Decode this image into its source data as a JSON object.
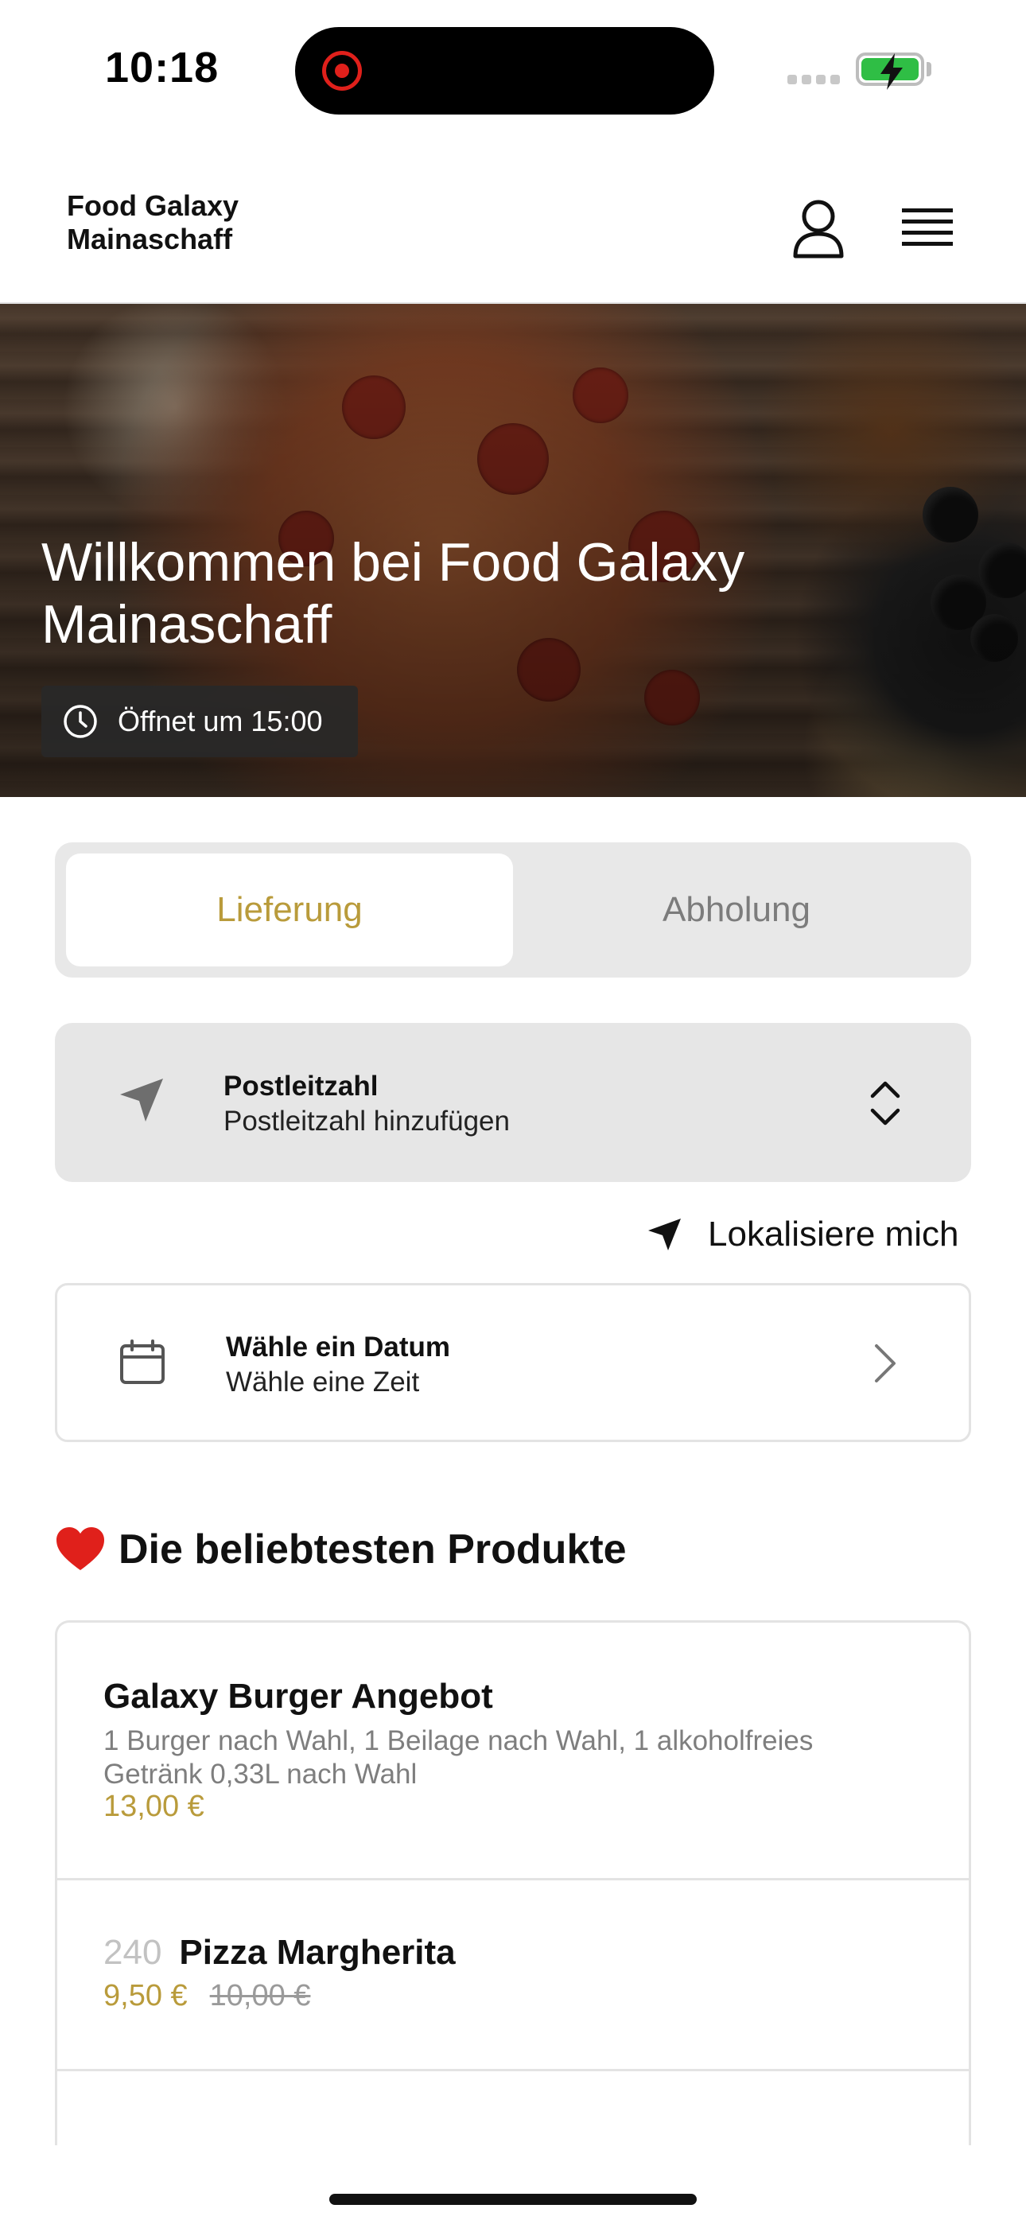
{
  "status_bar": {
    "time": "10:18",
    "battery_state": "charging"
  },
  "header": {
    "brand_line1": "Food Galaxy",
    "brand_line2": "Mainaschaff"
  },
  "hero": {
    "title": "Willkommen bei Food Galaxy Mainaschaff",
    "opening_badge": "Öffnet um 15:00"
  },
  "order_mode": {
    "tabs": [
      {
        "label": "Lieferung",
        "active": true
      },
      {
        "label": "Abholung",
        "active": false
      }
    ]
  },
  "postal_code": {
    "title": "Postleitzahl",
    "placeholder": "Postleitzahl hinzufügen"
  },
  "locate_me": {
    "label": "Lokalisiere mich"
  },
  "date_picker": {
    "title": "Wähle ein Datum",
    "subtitle": "Wähle eine Zeit"
  },
  "popular": {
    "title": "Die beliebtesten Produkte",
    "products": [
      {
        "number": "",
        "name": "Galaxy Burger Angebot",
        "description": "1 Burger nach Wahl, 1 Beilage nach Wahl, 1 alkoholfreies Getränk 0,33L nach Wahl",
        "price": "13,00 €",
        "old_price": ""
      },
      {
        "number": "240",
        "name": "Pizza Margherita",
        "description": "",
        "price": "9,50 €",
        "old_price": "10,00 €"
      }
    ]
  },
  "colors": {
    "accent": "#b99b3b",
    "tab_bg": "#e8e8e8",
    "card_bg": "#e6e6e6",
    "heart": "#e0201b"
  },
  "icons": [
    "user-icon",
    "hamburger-menu-icon",
    "clock-icon",
    "navigation-arrow-icon",
    "chevron-up-down-icon",
    "location-arrow-icon",
    "calendar-icon",
    "chevron-right-icon",
    "heart-icon"
  ]
}
